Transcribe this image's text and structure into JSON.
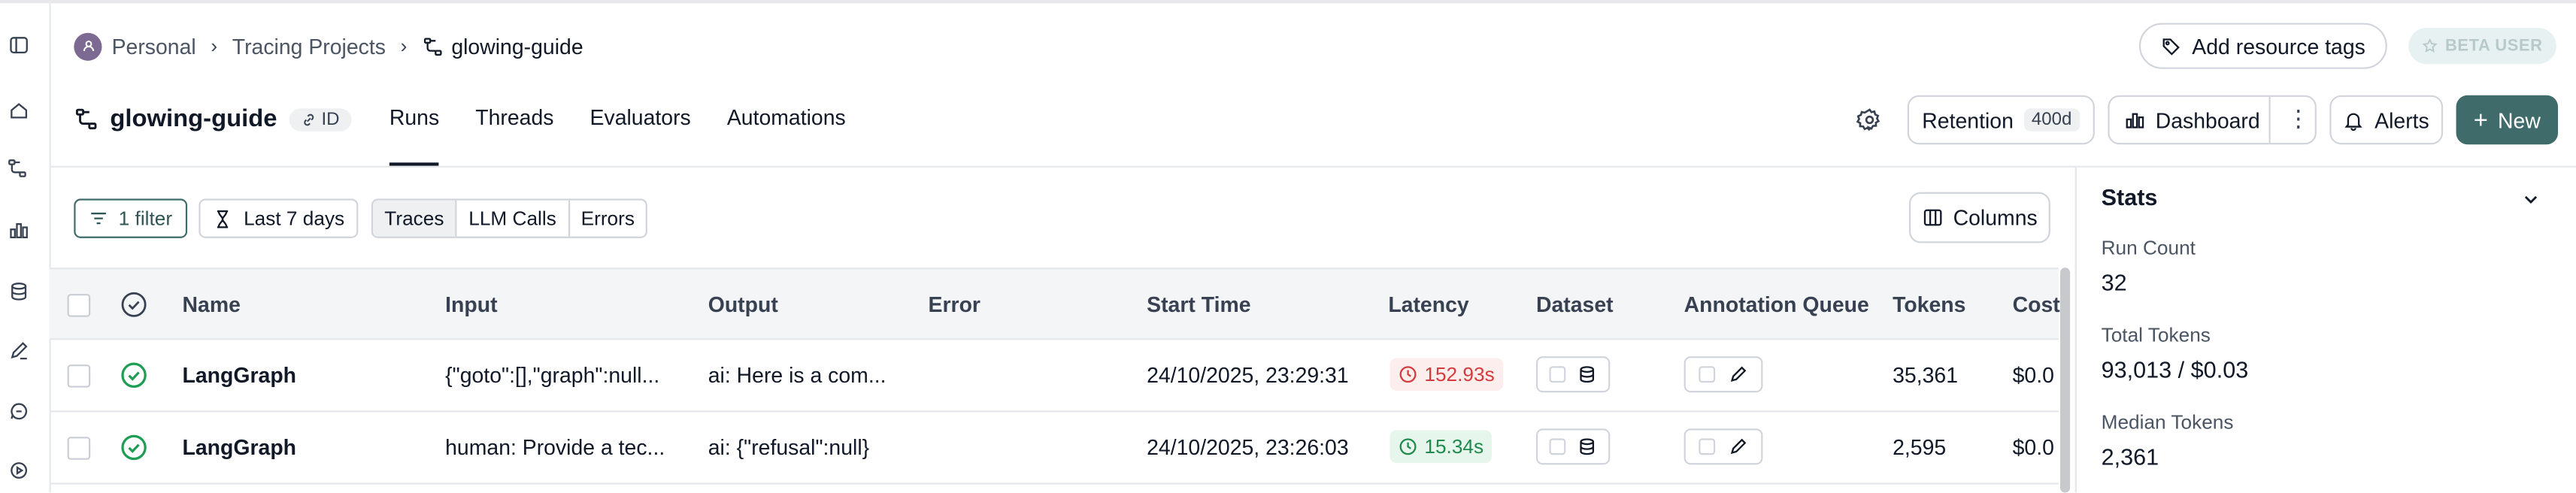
{
  "breadcrumb": {
    "workspace": "Personal",
    "section": "Tracing Projects",
    "project": "glowing-guide"
  },
  "header": {
    "add_tags": "Add resource tags",
    "beta": "BETA USER"
  },
  "project": {
    "title": "glowing-guide",
    "id_label": "ID"
  },
  "tabs": [
    "Runs",
    "Threads",
    "Evaluators",
    "Automations"
  ],
  "actions": {
    "retention_label": "Retention",
    "retention_value": "400d",
    "dashboard": "Dashboard",
    "alerts": "Alerts",
    "new": "New"
  },
  "toolbar": {
    "filter": "1 filter",
    "range": "Last 7 days",
    "segments": [
      "Traces",
      "LLM Calls",
      "Errors"
    ],
    "columns": "Columns"
  },
  "table": {
    "columns": [
      "Name",
      "Input",
      "Output",
      "Error",
      "Start Time",
      "Latency",
      "Dataset",
      "Annotation Queue",
      "Tokens",
      "Cost"
    ],
    "rows": [
      {
        "name": "LangGraph",
        "input": "{\"goto\":[],\"graph\":null...",
        "output": "ai: Here is a com...",
        "error": "",
        "start": "24/10/2025, 23:29:31",
        "latency": "152.93s",
        "latency_status": "slow",
        "tokens": "35,361",
        "cost": "$0.0"
      },
      {
        "name": "LangGraph",
        "input": "human: Provide a tec...",
        "output": "ai: {\"refusal\":null}",
        "error": "",
        "start": "24/10/2025, 23:26:03",
        "latency": "15.34s",
        "latency_status": "ok",
        "tokens": "2,595",
        "cost": "$0.0"
      }
    ]
  },
  "stats": {
    "title": "Stats",
    "items": [
      {
        "label": "Run Count",
        "value": "32"
      },
      {
        "label": "Total Tokens",
        "value": "93,013 / $0.03"
      },
      {
        "label": "Median Tokens",
        "value": "2,361"
      }
    ]
  },
  "colors": {
    "accent": "#3f6b6a",
    "latency_slow": "#d33c3c",
    "latency_ok": "#1f8a4c",
    "success": "#1f9d55"
  },
  "icons": [
    "sidebar-toggle-icon",
    "home-icon",
    "tracing-icon",
    "chart-icon",
    "database-icon",
    "pen-icon",
    "chat-icon",
    "play-icon",
    "tag-icon",
    "star-icon",
    "link-icon",
    "gear-icon",
    "bell-icon",
    "plus-icon",
    "filter-icon",
    "hourglass-icon",
    "columns-icon",
    "check-circle-icon",
    "clock-icon",
    "edit-icon",
    "chevron-down-icon"
  ]
}
